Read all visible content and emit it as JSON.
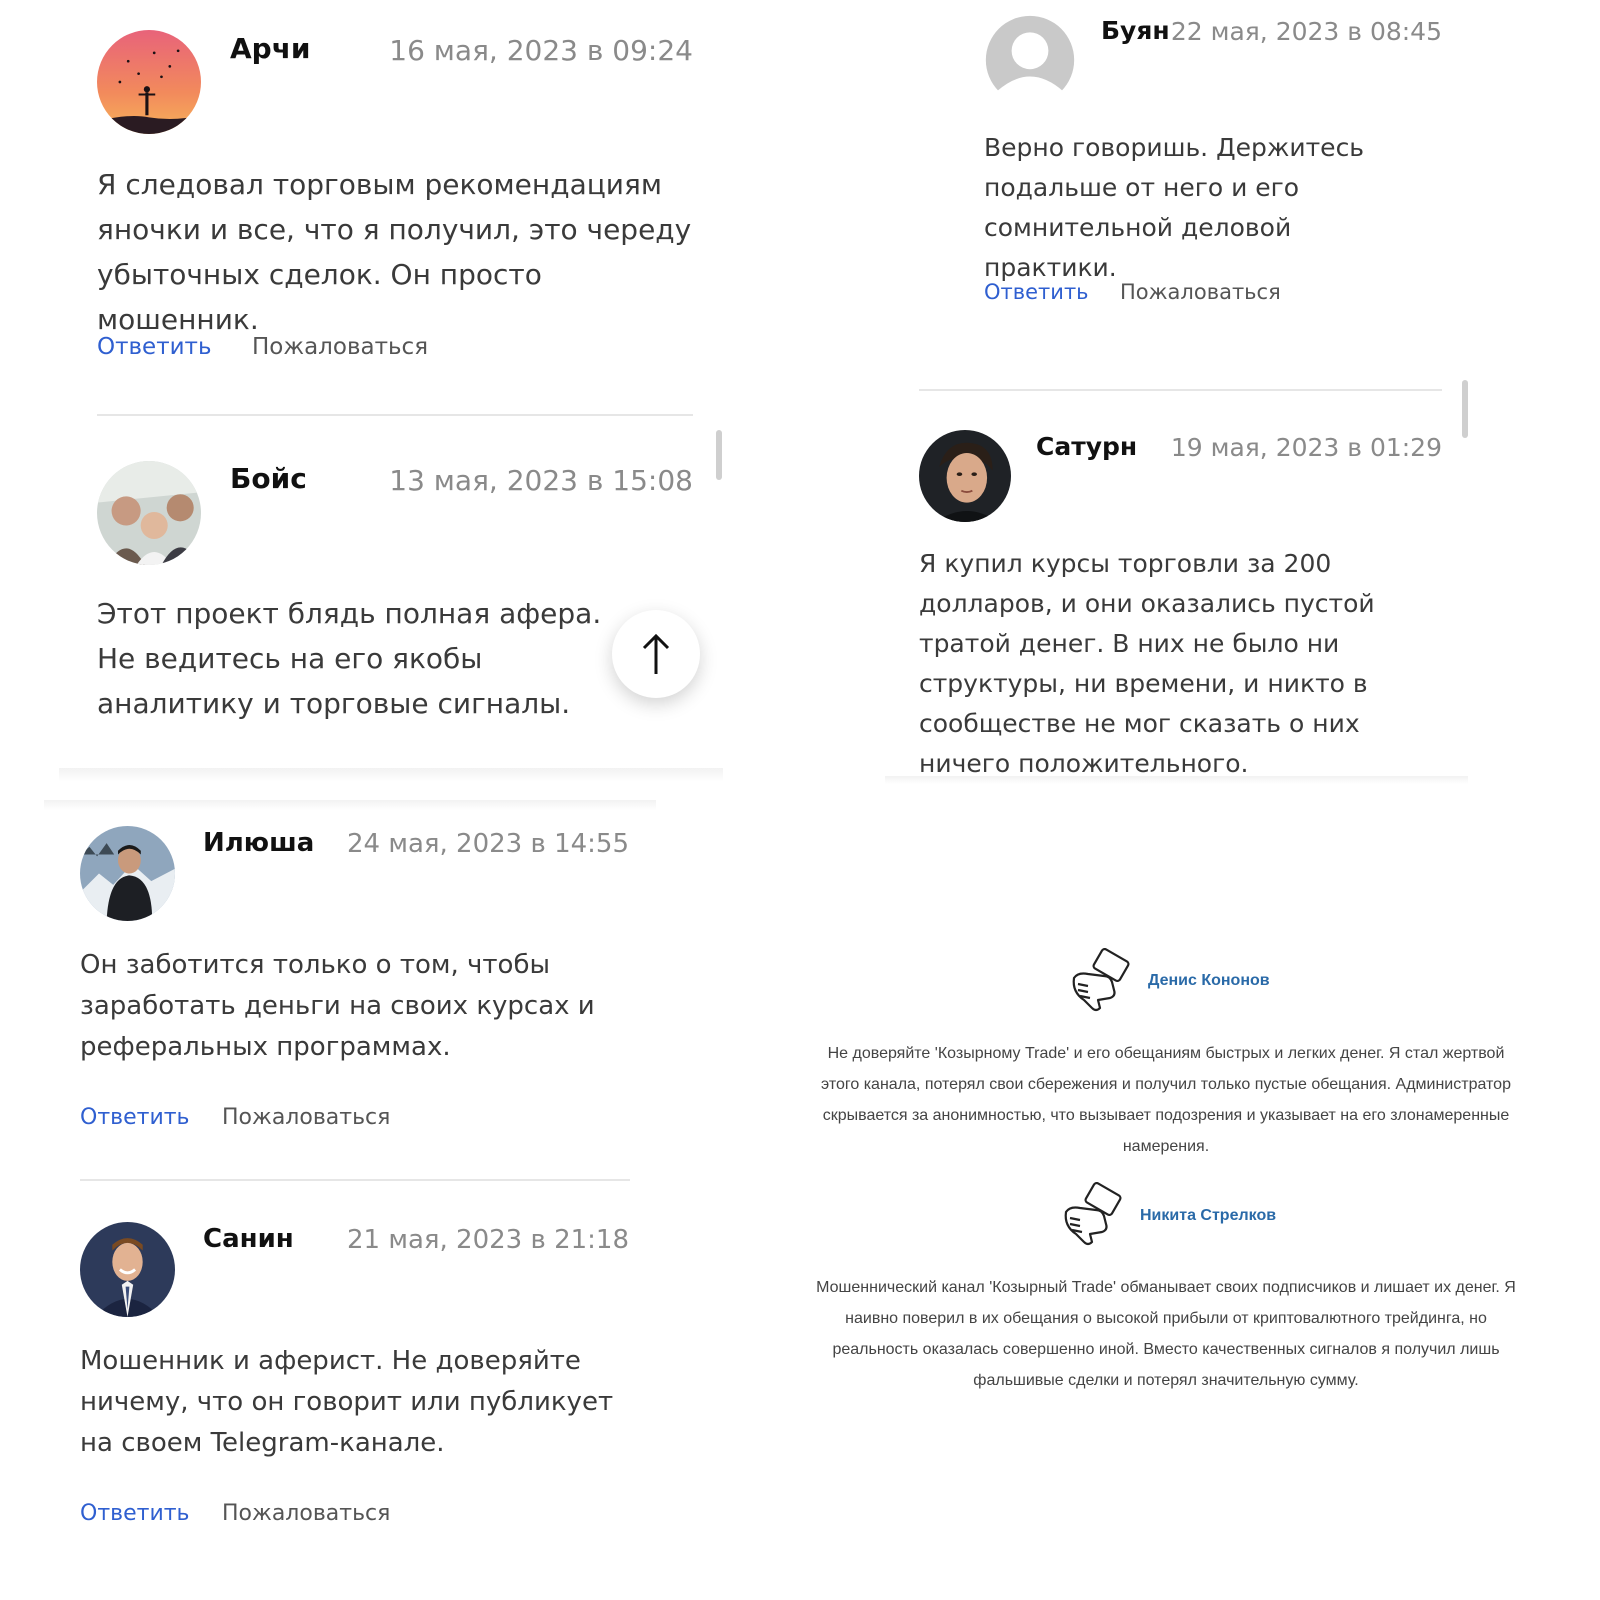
{
  "comments": {
    "archi": {
      "author": "Арчи",
      "date": "16 мая, 2023 в 09:24",
      "text": "Я следовал торговым рекомендациям яночки и все, что я получил, это череду убыточных сделок. Он просто мошенник.",
      "reply": "Ответить",
      "report": "Пожаловаться"
    },
    "boys": {
      "author": "Бойс",
      "date": "13 мая, 2023 в 15:08",
      "text": "Этот проект блядь полная афера. Не ведитесь на его якобы аналитику и торговые сигналы."
    },
    "buyan": {
      "author": "Буян",
      "date": "22 мая, 2023 в 08:45",
      "text": "Верно говоришь. Держитесь подальше от него и его сомнительной деловой практики.",
      "reply": "Ответить",
      "report": "Пожаловаться"
    },
    "saturn": {
      "author": "Сатурн",
      "date": "19 мая, 2023 в 01:29",
      "text": "Я купил курсы торговли за 200 долларов, и они оказались пустой тратой денег. В них не было ни структуры, ни времени, и никто в сообществе не мог сказать о них ничего положительного."
    },
    "ilyusha": {
      "author": "Илюша",
      "date": "24 мая, 2023 в 14:55",
      "text": "Он заботится только о том, чтобы заработать деньги на своих курсах и реферальных программах.",
      "reply": "Ответить",
      "report": "Пожаловаться"
    },
    "sanin": {
      "author": "Санин",
      "date": "21 мая, 2023 в 21:18",
      "text": "Мошенник и аферист. Не доверяйте ничему, что он говорит или публикует на своем Telegram-канале.",
      "reply": "Ответить",
      "report": "Пожаловаться"
    }
  },
  "reviews": {
    "kononov": {
      "author": "Денис Кононов",
      "icon": "thumbs-down-icon",
      "text": "Не доверяйте 'Козырному Trade' и его обещаниям быстрых и легких денег. Я стал жертвой этого канала, потерял свои сбережения и получил только пустые обещания. Администратор скрывается за анонимностью, что вызывает подозрения и указывает на его злонамеренные намерения."
    },
    "strelkov": {
      "author": "Никита Стрелков",
      "icon": "thumbs-down-icon",
      "text": "Мошеннический канал 'Козырный Trade' обманывает своих подписчиков и лишает их денег. Я наивно поверил в их обещания о высокой прибыли от криптовалютного трейдинга, но реальность оказалась совершенно иной. Вместо качественных сигналов я получил лишь фальшивые сделки и потерял значительную сумму."
    }
  },
  "icons": {
    "scroll_top": "arrow-up-icon"
  },
  "colors": {
    "link": "#2f5fd0",
    "review_name": "#2a6aa8",
    "date": "#8a8a8a"
  }
}
